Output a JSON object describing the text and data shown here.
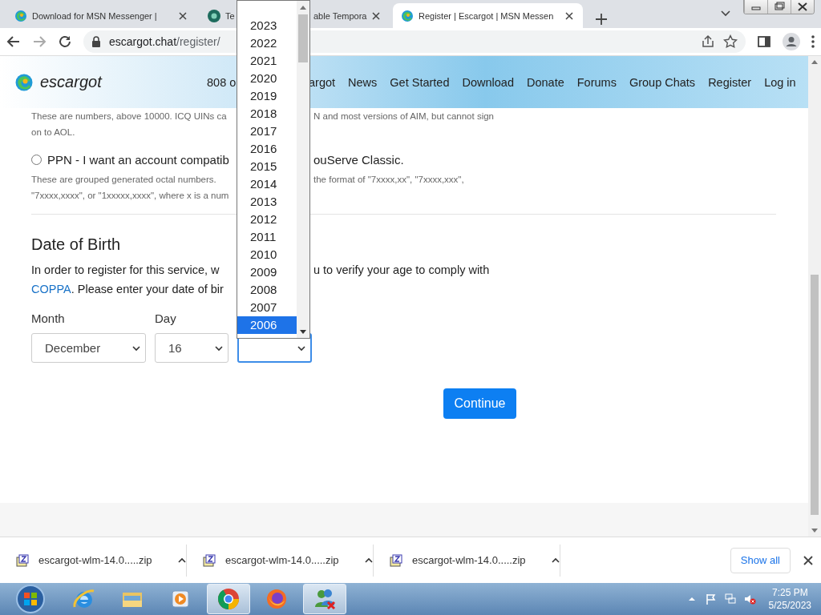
{
  "browser": {
    "tabs": [
      {
        "parts": [
          "Download for MSN Messenger |"
        ],
        "selected": false
      },
      {
        "parts": [
          "Te",
          "able Tempora"
        ],
        "selected": false
      },
      {
        "parts": [
          "Register | Escargot | MSN Messen"
        ],
        "selected": true
      }
    ],
    "address": {
      "host": "escargot.chat",
      "path": "/register/"
    }
  },
  "site_header": {
    "logo": "escargot",
    "nav_left": "808 o",
    "nav": [
      "argot",
      "News",
      "Get Started",
      "Download",
      "Donate",
      "Forums",
      "Group Chats",
      "Register",
      "Log in"
    ]
  },
  "uin_note": [
    {
      "left": "These are numbers, above 10000. ICQ UINs ca",
      "right": "N and most versions of AIM, but cannot sign"
    },
    {
      "left": "on to AOL."
    }
  ],
  "ppn_option": {
    "left": "PPN - I want an account compatib",
    "right": "ouServe Classic.",
    "selected": false,
    "note": [
      {
        "left": "These are grouped generated octal numbers.",
        "right": "the format of \"7xxxx,xx\", \"7xxxx,xxx\","
      },
      {
        "left": "\"7xxxx,xxxx\", or \"1xxxxx,xxxx\", where x is a num"
      }
    ]
  },
  "dob": {
    "title": "Date of Birth",
    "intro": [
      {
        "left": "In order to register for this service, w",
        "right": "u to verify your age to comply with"
      },
      {
        "link": "COPPA",
        "left": ". Please enter your date of bir"
      }
    ],
    "month": {
      "label": "Month",
      "value": "December"
    },
    "day": {
      "label": "Day",
      "value": "16"
    },
    "year": {
      "focused": true
    },
    "year_options": [
      {
        "label": "2023",
        "selected": false
      },
      {
        "label": "2022",
        "selected": false
      },
      {
        "label": "2021",
        "selected": false
      },
      {
        "label": "2020",
        "selected": false
      },
      {
        "label": "2019",
        "selected": false
      },
      {
        "label": "2018",
        "selected": false
      },
      {
        "label": "2017",
        "selected": false
      },
      {
        "label": "2016",
        "selected": false
      },
      {
        "label": "2015",
        "selected": false
      },
      {
        "label": "2014",
        "selected": false
      },
      {
        "label": "2013",
        "selected": false
      },
      {
        "label": "2012",
        "selected": false
      },
      {
        "label": "2011",
        "selected": false
      },
      {
        "label": "2010",
        "selected": false
      },
      {
        "label": "2009",
        "selected": false
      },
      {
        "label": "2008",
        "selected": false
      },
      {
        "label": "2007",
        "selected": false
      },
      {
        "label": "2006",
        "selected": true
      }
    ],
    "continue": "Continue"
  },
  "downloads": {
    "items": [
      "escargot-wlm-14.0.....zip",
      "escargot-wlm-14.0.....zip",
      "escargot-wlm-14.0.....zip"
    ],
    "show_all": "Show all"
  },
  "taskbar": {
    "apps": [
      {
        "kind": "ie",
        "running": false
      },
      {
        "kind": "folder",
        "running": false
      },
      {
        "kind": "media",
        "running": false
      },
      {
        "kind": "chrome",
        "running": true
      },
      {
        "kind": "firefox",
        "running": false
      },
      {
        "kind": "messenger",
        "running": true
      }
    ],
    "time": "7:25 PM",
    "date": "5/25/2023"
  }
}
